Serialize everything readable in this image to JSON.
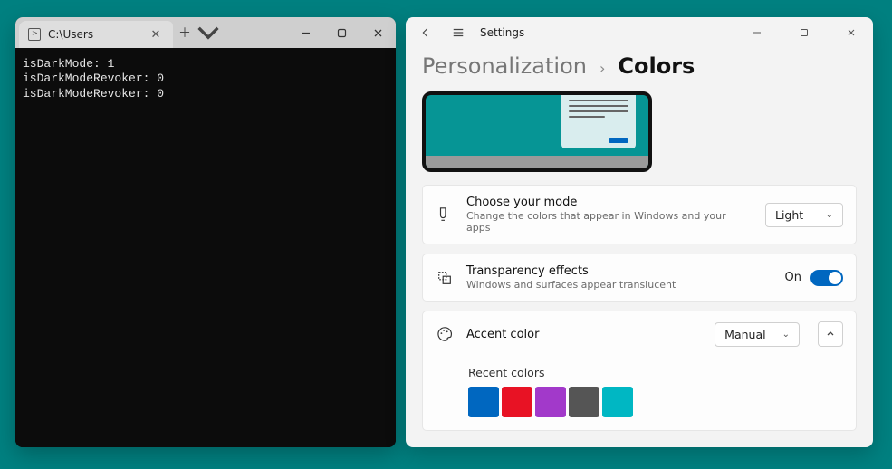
{
  "terminal": {
    "tab_title": "C:\\Users",
    "lines": [
      "isDarkMode: 1",
      "isDarkModeRevoker: 0",
      "isDarkModeRevoker: 0"
    ]
  },
  "settings": {
    "app_title": "Settings",
    "breadcrumb": {
      "parent": "Personalization",
      "current": "Colors"
    },
    "mode": {
      "title": "Choose your mode",
      "subtitle": "Change the colors that appear in Windows and your apps",
      "value": "Light"
    },
    "transparency": {
      "title": "Transparency effects",
      "subtitle": "Windows and surfaces appear translucent",
      "state_label": "On",
      "on": true
    },
    "accent": {
      "title": "Accent color",
      "value": "Manual"
    },
    "recent": {
      "label": "Recent colors",
      "colors": [
        "#0067c0",
        "#e81224",
        "#a239ca",
        "#555555",
        "#00b7c3"
      ]
    }
  }
}
